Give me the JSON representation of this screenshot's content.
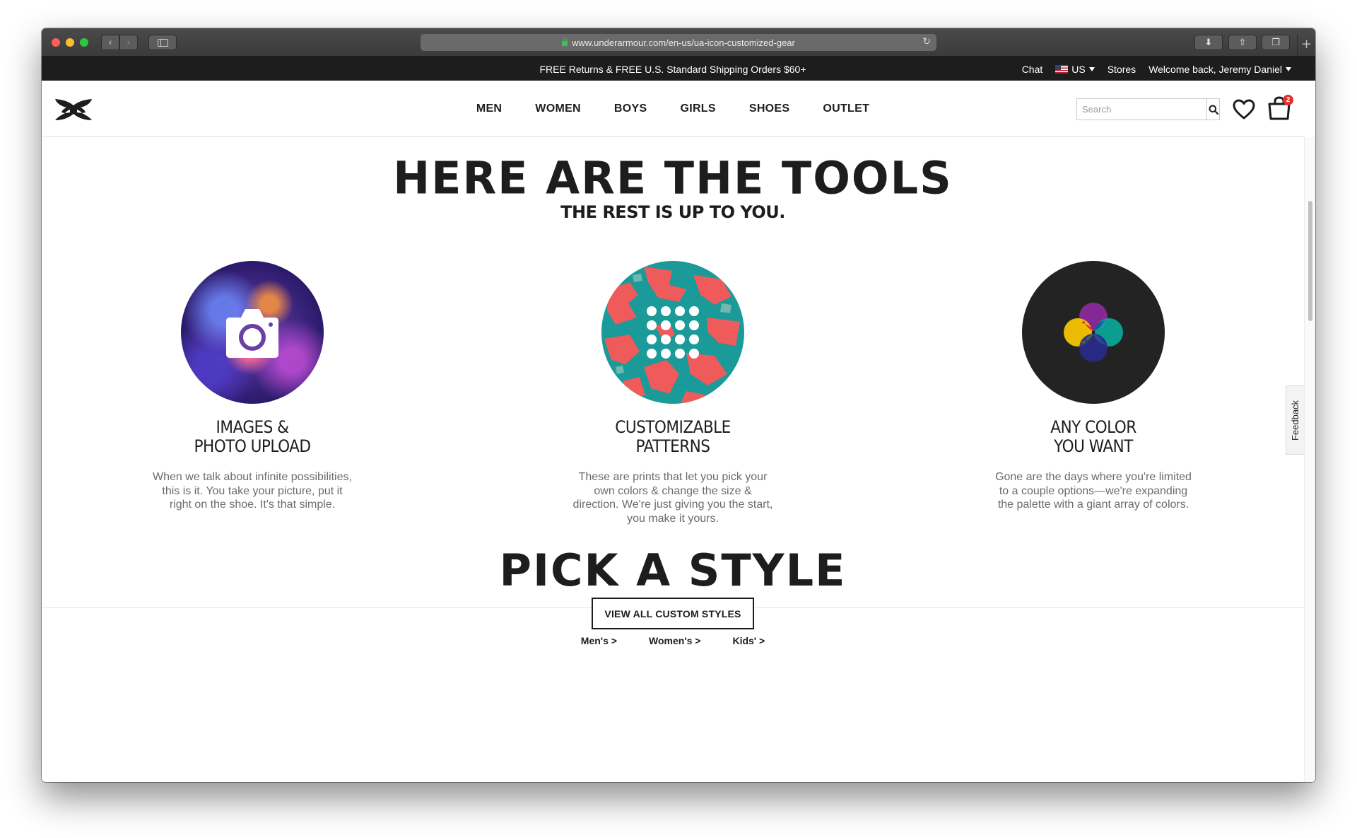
{
  "browser": {
    "url": "www.underarmour.com/en-us/ua-icon-customized-gear",
    "back_glyph": "‹",
    "forward_glyph": "›",
    "reload_glyph": "↻",
    "download_glyph": "⬇",
    "share_glyph": "⇧",
    "tabs_glyph": "❐",
    "newtab_glyph": "+"
  },
  "promo": {
    "text": "FREE Returns & FREE U.S. Standard Shipping Orders $60+",
    "chat": "Chat",
    "region": "US",
    "stores": "Stores",
    "welcome": "Welcome back, Jeremy Daniel"
  },
  "nav": {
    "items": [
      "MEN",
      "WOMEN",
      "BOYS",
      "GIRLS",
      "SHOES",
      "OUTLET"
    ]
  },
  "search": {
    "placeholder": "Search"
  },
  "cart": {
    "count": "2"
  },
  "feedback": {
    "label": "Feedback"
  },
  "tools": {
    "title": "HERE ARE THE TOOLS",
    "subtitle": "THE REST IS UP TO YOU.",
    "features": [
      {
        "title_line1": "IMAGES &",
        "title_line2": "PHOTO UPLOAD",
        "text": "When we talk about infinite possibilities, this is it. You take your picture, put it right on the shoe. It's that simple.",
        "icon": "camera-icon"
      },
      {
        "title_line1": "CUSTOMIZABLE",
        "title_line2": "PATTERNS",
        "text": "These are prints that let you pick your own colors & change the size & direction. We're just giving you the start, you make it yours.",
        "icon": "pattern-grid-icon"
      },
      {
        "title_line1": "ANY COLOR",
        "title_line2": "YOU WANT",
        "text": "Gone are the days where you're limited to a couple options—we're expanding the palette with a giant array of colors.",
        "icon": "color-wheel-icon"
      }
    ]
  },
  "styles": {
    "title": "PICK A STYLE",
    "button": "VIEW ALL CUSTOM STYLES",
    "links": [
      "Men's  >",
      "Women's  >",
      "Kids'  >"
    ]
  },
  "colors": {
    "accent_dark": "#1d1d1d",
    "badge_red": "#e0312a",
    "pattern_teal": "#1a9a98",
    "pattern_coral": "#ef5a5a",
    "wheel_yellow": "#f5c400",
    "wheel_purple": "#8a2a9a",
    "wheel_teal": "#0aa89a",
    "wheel_navy": "#2a2a8a"
  }
}
